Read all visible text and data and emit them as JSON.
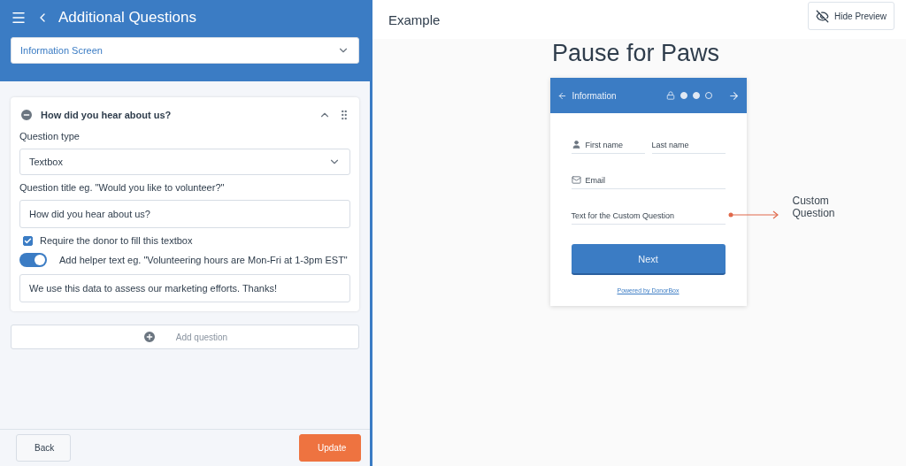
{
  "editor": {
    "title": "Additional Questions",
    "screen_select": {
      "value": "Information Screen"
    },
    "question": {
      "title": "How did you hear about us?",
      "expanded": true,
      "type_label": "Question type",
      "type_value": "Textbox",
      "title_label": "Question title eg. \"Would you like to volunteer?\"",
      "title_value": "How did you hear about us?",
      "require": {
        "label": "Require the donor to fill this textbox",
        "checked": true
      },
      "helper": {
        "label": "Add helper text eg. \"Volunteering hours are Mon-Fri at 1-3pm EST\"",
        "on": true
      },
      "helper_value": "We use this data to assess our marketing efforts. Thanks!"
    },
    "add_question": "Add question",
    "buttons": {
      "back": "Back",
      "update": "Update"
    }
  },
  "preview": {
    "heading": "Example",
    "hide_button": "Hide Preview",
    "campaign_title": "Pause for Paws",
    "form": {
      "title": "Information",
      "steps": [
        {
          "done": true
        },
        {
          "done": true
        },
        {
          "done": false
        }
      ],
      "fields": [
        {
          "kind": "person",
          "placeholder": "First name"
        },
        {
          "kind": "plain",
          "placeholder": "Last name"
        },
        {
          "kind": "mail",
          "placeholder": "Email"
        },
        {
          "kind": "plain",
          "placeholder": "Text for the Custom Question"
        }
      ],
      "next": "Next",
      "powered": "Powered by DonorBox"
    },
    "annotation": "Custom Question"
  }
}
